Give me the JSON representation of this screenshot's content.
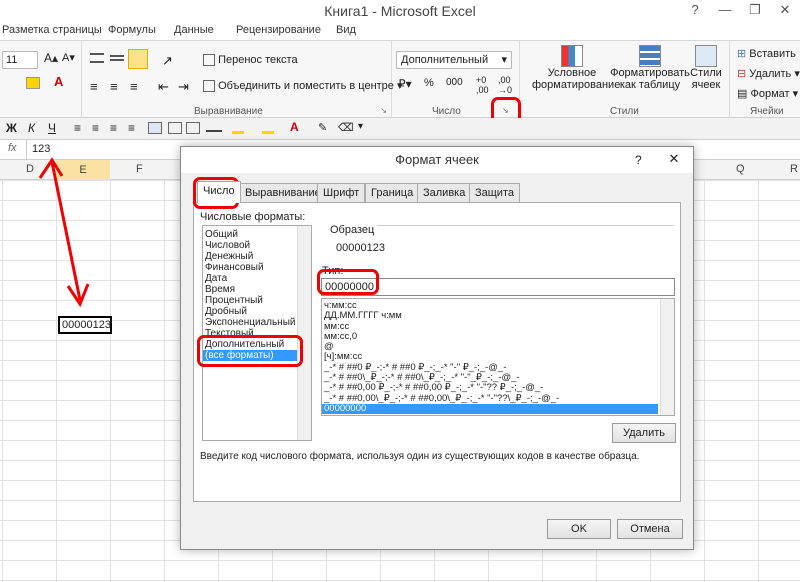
{
  "window": {
    "title": "Книга1 - Microsoft Excel",
    "controls": [
      "?",
      "—",
      "❐",
      "✕"
    ]
  },
  "ribbon_tabs": [
    "Разметка страницы",
    "Формулы",
    "Данные",
    "Рецензирование",
    "Вид"
  ],
  "ribbon": {
    "font_size": "11",
    "wrap_text": "Перенос текста",
    "merge_center": "Объединить и поместить в центре",
    "alignment_group": "Выравнивание",
    "number_format_value": "Дополнительный",
    "number_group": "Число",
    "cond_format_line1": "Условное",
    "cond_format_line2": "форматирование",
    "format_table_line1": "Форматировать",
    "format_table_line2": "как таблицу",
    "cell_styles_line1": "Стили",
    "cell_styles_line2": "ячеек",
    "styles_group": "Стили",
    "insert": "Вставить",
    "delete": "Удалить",
    "format": "Формат",
    "cells_group": "Ячейки",
    "percent": "%",
    "thousands": "000"
  },
  "formula_bar": {
    "fx": "fx",
    "value": "123"
  },
  "columns": [
    "D",
    "E",
    "F",
    "Q",
    "R"
  ],
  "sheet": {
    "cell_value": "00000123"
  },
  "dialog": {
    "title": "Формат ячеек",
    "help": "?",
    "close": "✕",
    "tabs": [
      "Число",
      "Выравнивание",
      "Шрифт",
      "Граница",
      "Заливка",
      "Защита"
    ],
    "formats_label": "Числовые форматы:",
    "categories": [
      "Общий",
      "Числовой",
      "Денежный",
      "Финансовый",
      "Дата",
      "Время",
      "Процентный",
      "Дробный",
      "Экспоненциальный",
      "Текстовый",
      "Дополнительный",
      "(все форматы)"
    ],
    "sample_label": "Образец",
    "sample_value": "00000123",
    "type_label": "Тип:",
    "type_value": "00000000",
    "type_list": [
      "ч:мм:сс",
      "ДД.ММ.ГГГГ ч:мм",
      "мм:сс",
      "мм:сс,0",
      "@",
      "[ч]:мм:сс",
      "_-* # ##0 ₽_-;-* # ##0 ₽_-;_-* \"-\" ₽_-;_-@_-",
      "_-* # ##0\\_₽_-;-* # ##0\\_₽_-;_-* \"-\"_₽_-;_-@_-",
      "_-* # ##0,00 ₽_-;-* # ##0,00 ₽_-;_-* \"-\"?? ₽_-;_-@_-",
      "_-* # ##0,00\\_₽_-;-* # ##0,00\\_₽_-;_-* \"-\"??\\_₽_-;_-@_-",
      "00000000"
    ],
    "delete_button": "Удалить",
    "hint": "Введите код числового формата, используя один из существующих кодов в качестве образца.",
    "ok": "OK",
    "cancel": "Отмена"
  }
}
